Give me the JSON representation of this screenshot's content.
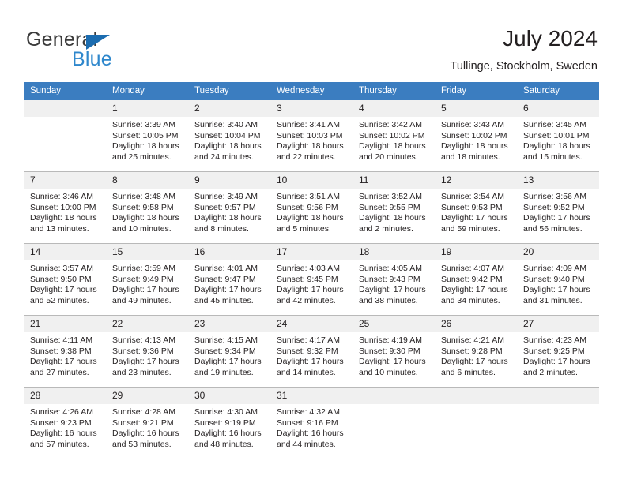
{
  "brand": {
    "name_part1": "General",
    "name_part2": "Blue",
    "triangle_color": "#1b6cb0",
    "blue_color": "#2e87cc",
    "gray_color": "#3b3b3b"
  },
  "header": {
    "title": "July 2024",
    "subtitle": "Tullinge, Stockholm, Sweden"
  },
  "colors": {
    "header_row_bg": "#3b7dc0",
    "header_row_text": "#ffffff",
    "daynum_band_bg": "#f0f0f0",
    "grid_line": "#b9b9b9",
    "text": "#231f20"
  },
  "weekday_headers": [
    "Sunday",
    "Monday",
    "Tuesday",
    "Wednesday",
    "Thursday",
    "Friday",
    "Saturday"
  ],
  "labels": {
    "sunrise_prefix": "Sunrise:",
    "sunset_prefix": "Sunset:",
    "daylight_prefix": "Daylight:"
  },
  "weeks": [
    [
      {
        "day": "",
        "line1": "",
        "line2": "",
        "line3": "",
        "line4": ""
      },
      {
        "day": "1",
        "line1": "Sunrise: 3:39 AM",
        "line2": "Sunset: 10:05 PM",
        "line3": "Daylight: 18 hours",
        "line4": "and 25 minutes."
      },
      {
        "day": "2",
        "line1": "Sunrise: 3:40 AM",
        "line2": "Sunset: 10:04 PM",
        "line3": "Daylight: 18 hours",
        "line4": "and 24 minutes."
      },
      {
        "day": "3",
        "line1": "Sunrise: 3:41 AM",
        "line2": "Sunset: 10:03 PM",
        "line3": "Daylight: 18 hours",
        "line4": "and 22 minutes."
      },
      {
        "day": "4",
        "line1": "Sunrise: 3:42 AM",
        "line2": "Sunset: 10:02 PM",
        "line3": "Daylight: 18 hours",
        "line4": "and 20 minutes."
      },
      {
        "day": "5",
        "line1": "Sunrise: 3:43 AM",
        "line2": "Sunset: 10:02 PM",
        "line3": "Daylight: 18 hours",
        "line4": "and 18 minutes."
      },
      {
        "day": "6",
        "line1": "Sunrise: 3:45 AM",
        "line2": "Sunset: 10:01 PM",
        "line3": "Daylight: 18 hours",
        "line4": "and 15 minutes."
      }
    ],
    [
      {
        "day": "7",
        "line1": "Sunrise: 3:46 AM",
        "line2": "Sunset: 10:00 PM",
        "line3": "Daylight: 18 hours",
        "line4": "and 13 minutes."
      },
      {
        "day": "8",
        "line1": "Sunrise: 3:48 AM",
        "line2": "Sunset: 9:58 PM",
        "line3": "Daylight: 18 hours",
        "line4": "and 10 minutes."
      },
      {
        "day": "9",
        "line1": "Sunrise: 3:49 AM",
        "line2": "Sunset: 9:57 PM",
        "line3": "Daylight: 18 hours",
        "line4": "and 8 minutes."
      },
      {
        "day": "10",
        "line1": "Sunrise: 3:51 AM",
        "line2": "Sunset: 9:56 PM",
        "line3": "Daylight: 18 hours",
        "line4": "and 5 minutes."
      },
      {
        "day": "11",
        "line1": "Sunrise: 3:52 AM",
        "line2": "Sunset: 9:55 PM",
        "line3": "Daylight: 18 hours",
        "line4": "and 2 minutes."
      },
      {
        "day": "12",
        "line1": "Sunrise: 3:54 AM",
        "line2": "Sunset: 9:53 PM",
        "line3": "Daylight: 17 hours",
        "line4": "and 59 minutes."
      },
      {
        "day": "13",
        "line1": "Sunrise: 3:56 AM",
        "line2": "Sunset: 9:52 PM",
        "line3": "Daylight: 17 hours",
        "line4": "and 56 minutes."
      }
    ],
    [
      {
        "day": "14",
        "line1": "Sunrise: 3:57 AM",
        "line2": "Sunset: 9:50 PM",
        "line3": "Daylight: 17 hours",
        "line4": "and 52 minutes."
      },
      {
        "day": "15",
        "line1": "Sunrise: 3:59 AM",
        "line2": "Sunset: 9:49 PM",
        "line3": "Daylight: 17 hours",
        "line4": "and 49 minutes."
      },
      {
        "day": "16",
        "line1": "Sunrise: 4:01 AM",
        "line2": "Sunset: 9:47 PM",
        "line3": "Daylight: 17 hours",
        "line4": "and 45 minutes."
      },
      {
        "day": "17",
        "line1": "Sunrise: 4:03 AM",
        "line2": "Sunset: 9:45 PM",
        "line3": "Daylight: 17 hours",
        "line4": "and 42 minutes."
      },
      {
        "day": "18",
        "line1": "Sunrise: 4:05 AM",
        "line2": "Sunset: 9:43 PM",
        "line3": "Daylight: 17 hours",
        "line4": "and 38 minutes."
      },
      {
        "day": "19",
        "line1": "Sunrise: 4:07 AM",
        "line2": "Sunset: 9:42 PM",
        "line3": "Daylight: 17 hours",
        "line4": "and 34 minutes."
      },
      {
        "day": "20",
        "line1": "Sunrise: 4:09 AM",
        "line2": "Sunset: 9:40 PM",
        "line3": "Daylight: 17 hours",
        "line4": "and 31 minutes."
      }
    ],
    [
      {
        "day": "21",
        "line1": "Sunrise: 4:11 AM",
        "line2": "Sunset: 9:38 PM",
        "line3": "Daylight: 17 hours",
        "line4": "and 27 minutes."
      },
      {
        "day": "22",
        "line1": "Sunrise: 4:13 AM",
        "line2": "Sunset: 9:36 PM",
        "line3": "Daylight: 17 hours",
        "line4": "and 23 minutes."
      },
      {
        "day": "23",
        "line1": "Sunrise: 4:15 AM",
        "line2": "Sunset: 9:34 PM",
        "line3": "Daylight: 17 hours",
        "line4": "and 19 minutes."
      },
      {
        "day": "24",
        "line1": "Sunrise: 4:17 AM",
        "line2": "Sunset: 9:32 PM",
        "line3": "Daylight: 17 hours",
        "line4": "and 14 minutes."
      },
      {
        "day": "25",
        "line1": "Sunrise: 4:19 AM",
        "line2": "Sunset: 9:30 PM",
        "line3": "Daylight: 17 hours",
        "line4": "and 10 minutes."
      },
      {
        "day": "26",
        "line1": "Sunrise: 4:21 AM",
        "line2": "Sunset: 9:28 PM",
        "line3": "Daylight: 17 hours",
        "line4": "and 6 minutes."
      },
      {
        "day": "27",
        "line1": "Sunrise: 4:23 AM",
        "line2": "Sunset: 9:25 PM",
        "line3": "Daylight: 17 hours",
        "line4": "and 2 minutes."
      }
    ],
    [
      {
        "day": "28",
        "line1": "Sunrise: 4:26 AM",
        "line2": "Sunset: 9:23 PM",
        "line3": "Daylight: 16 hours",
        "line4": "and 57 minutes."
      },
      {
        "day": "29",
        "line1": "Sunrise: 4:28 AM",
        "line2": "Sunset: 9:21 PM",
        "line3": "Daylight: 16 hours",
        "line4": "and 53 minutes."
      },
      {
        "day": "30",
        "line1": "Sunrise: 4:30 AM",
        "line2": "Sunset: 9:19 PM",
        "line3": "Daylight: 16 hours",
        "line4": "and 48 minutes."
      },
      {
        "day": "31",
        "line1": "Sunrise: 4:32 AM",
        "line2": "Sunset: 9:16 PM",
        "line3": "Daylight: 16 hours",
        "line4": "and 44 minutes."
      },
      {
        "day": "",
        "line1": "",
        "line2": "",
        "line3": "",
        "line4": ""
      },
      {
        "day": "",
        "line1": "",
        "line2": "",
        "line3": "",
        "line4": ""
      },
      {
        "day": "",
        "line1": "",
        "line2": "",
        "line3": "",
        "line4": ""
      }
    ]
  ]
}
